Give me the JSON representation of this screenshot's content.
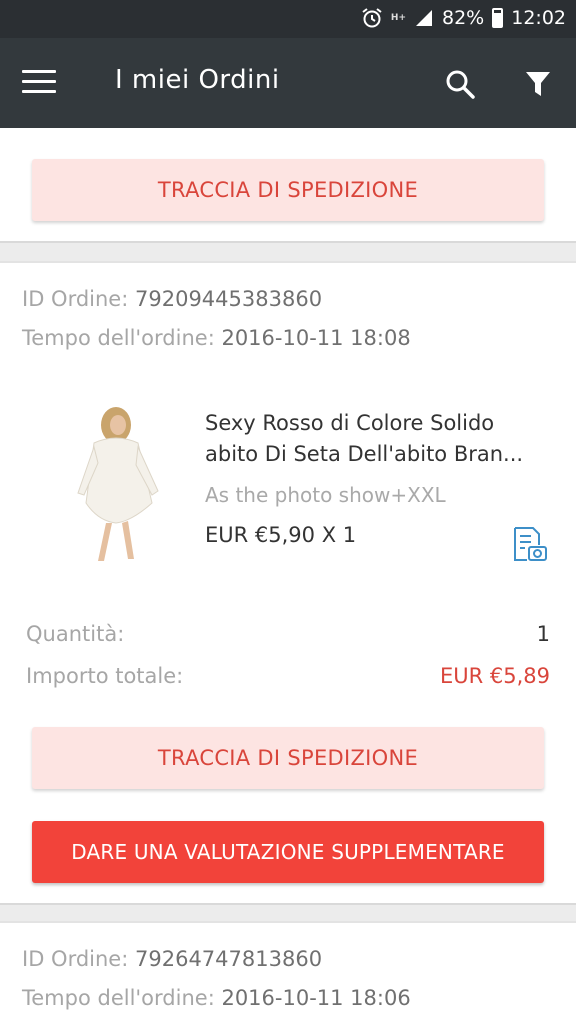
{
  "status_bar": {
    "battery": "82%",
    "time": "12:02",
    "network": "H+"
  },
  "app_bar": {
    "title": "I miei Ordini"
  },
  "track_label": "TRACCIA DI SPEDIZIONE",
  "rate_label": "DARE UNA VALUTAZIONE SUPPLEMENTARE",
  "labels": {
    "order_id": "ID Ordine:",
    "order_time": "Tempo dell'ordine:",
    "quantity": "Quantità:",
    "total": "Importo totale:"
  },
  "orders": [
    {
      "id": "79209445383860",
      "time": "2016-10-11 18:08",
      "product": {
        "name_line1": "Sexy Rosso di Colore Solido",
        "name_line2": "abito Di Seta Dell'abito Bran...",
        "variant": "As the photo show+XXL",
        "price": "EUR €5,90 X 1"
      },
      "quantity": "1",
      "total": "EUR €5,89"
    },
    {
      "id": "79264747813860",
      "time": "2016-10-11 18:06"
    }
  ],
  "colors": {
    "accent_red": "#f2433a",
    "track_bg": "#fde4e2",
    "appbar": "#33393d"
  }
}
